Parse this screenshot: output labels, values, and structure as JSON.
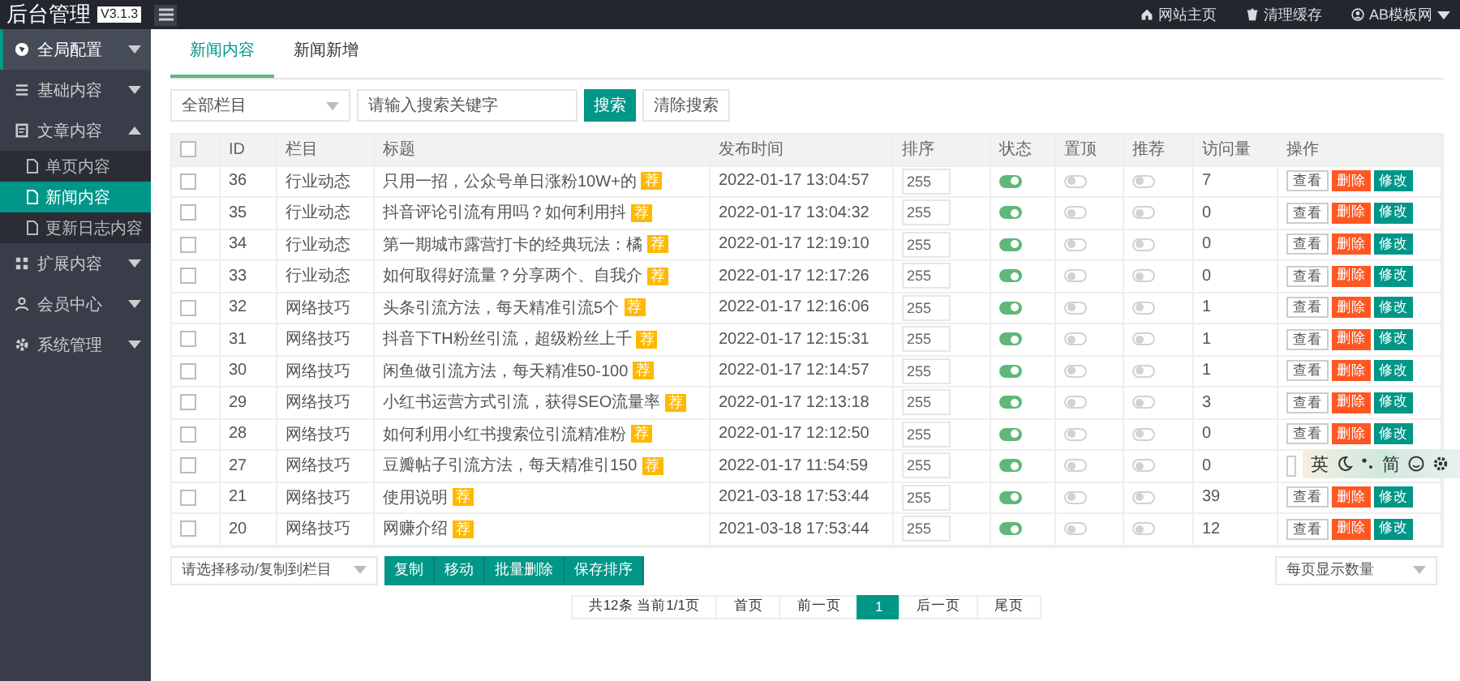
{
  "app": {
    "title": "后台管理",
    "version": "V3.1.3"
  },
  "top_nav": [
    {
      "label": "网站主页"
    },
    {
      "label": "清理缓存"
    },
    {
      "label": "AB模板网",
      "dropdown": true
    }
  ],
  "sidebar": {
    "items": [
      {
        "label": "全局配置",
        "active": true,
        "expanded": false
      },
      {
        "label": "基础内容",
        "active": false,
        "expanded": false
      },
      {
        "label": "文章内容",
        "active": false,
        "expanded": true,
        "children": [
          {
            "label": "单页内容",
            "selected": false
          },
          {
            "label": "新闻内容",
            "selected": true
          },
          {
            "label": "更新日志内容",
            "selected": false
          }
        ]
      },
      {
        "label": "扩展内容",
        "active": false,
        "expanded": false
      },
      {
        "label": "会员中心",
        "active": false,
        "expanded": false
      },
      {
        "label": "系统管理",
        "active": false,
        "expanded": false
      }
    ]
  },
  "tabs": [
    {
      "label": "新闻内容",
      "selected": true
    },
    {
      "label": "新闻新增",
      "selected": false
    }
  ],
  "filter": {
    "category": "全部栏目",
    "search": {
      "placeholder": "请输入搜索关键字"
    },
    "search_button": "搜索",
    "clear_button": "清除搜索"
  },
  "table": {
    "select_all": false,
    "columns": [
      "ID",
      "栏目",
      "标题",
      "发布时间",
      "排序",
      "状态",
      "置顶",
      "推荐",
      "访问量",
      "操作"
    ],
    "rows": [
      {
        "checked": false,
        "id": "36",
        "category": "行业动态",
        "title": "只用一招，公众号单日涨粉10W+的",
        "badge": "荐",
        "time": "2022-01-17 13:04:57",
        "sort": "255",
        "status": true,
        "top": false,
        "recommend": false,
        "visits": "7",
        "actions": [
          "查看",
          "删除",
          "修改"
        ]
      },
      {
        "checked": false,
        "id": "35",
        "category": "行业动态",
        "title": "抖音评论引流有用吗？如何利用抖",
        "badge": "荐",
        "time": "2022-01-17 13:04:32",
        "sort": "255",
        "status": true,
        "top": false,
        "recommend": false,
        "visits": "0",
        "actions": [
          "查看",
          "删除",
          "修改"
        ]
      },
      {
        "checked": false,
        "id": "34",
        "category": "行业动态",
        "title": "第一期城市露营打卡的经典玩法：橘",
        "badge": "荐",
        "time": "2022-01-17 12:19:10",
        "sort": "255",
        "status": true,
        "top": false,
        "recommend": false,
        "visits": "0",
        "actions": [
          "查看",
          "删除",
          "修改"
        ]
      },
      {
        "checked": false,
        "id": "33",
        "category": "行业动态",
        "title": "如何取得好流量？分享两个、自我介",
        "badge": "荐",
        "time": "2022-01-17 12:17:26",
        "sort": "255",
        "status": true,
        "top": false,
        "recommend": false,
        "visits": "0",
        "actions": [
          "查看",
          "删除",
          "修改"
        ]
      },
      {
        "checked": false,
        "id": "32",
        "category": "网络技巧",
        "title": "头条引流方法，每天精准引流5个",
        "badge": "荐",
        "time": "2022-01-17 12:16:06",
        "sort": "255",
        "status": true,
        "top": false,
        "recommend": false,
        "visits": "1",
        "actions": [
          "查看",
          "删除",
          "修改"
        ]
      },
      {
        "checked": false,
        "id": "31",
        "category": "网络技巧",
        "title": "抖音下TH粉丝引流，超级粉丝上千",
        "badge": "荐",
        "time": "2022-01-17 12:15:31",
        "sort": "255",
        "status": true,
        "top": false,
        "recommend": false,
        "visits": "1",
        "actions": [
          "查看",
          "删除",
          "修改"
        ]
      },
      {
        "checked": false,
        "id": "30",
        "category": "网络技巧",
        "title": "闲鱼做引流方法，每天精准50-100",
        "badge": "荐",
        "time": "2022-01-17 12:14:57",
        "sort": "255",
        "status": true,
        "top": false,
        "recommend": false,
        "visits": "1",
        "actions": [
          "查看",
          "删除",
          "修改"
        ]
      },
      {
        "checked": false,
        "id": "29",
        "category": "网络技巧",
        "title": "小红书运营方式引流，获得SEO流量率",
        "badge": "荐",
        "time": "2022-01-17 12:13:18",
        "sort": "255",
        "status": true,
        "top": false,
        "recommend": false,
        "visits": "3",
        "actions": [
          "查看",
          "删除",
          "修改"
        ]
      },
      {
        "checked": false,
        "id": "28",
        "category": "网络技巧",
        "title": "如何利用小红书搜索位引流精准粉",
        "badge": "荐",
        "time": "2022-01-17 12:12:50",
        "sort": "255",
        "status": true,
        "top": false,
        "recommend": false,
        "visits": "0",
        "actions": [
          "查看",
          "删除",
          "修改"
        ]
      },
      {
        "checked": false,
        "id": "27",
        "category": "网络技巧",
        "title": "豆瓣帖子引流方法，每天精准引150",
        "badge": "荐",
        "time": "2022-01-17 11:54:59",
        "sort": "255",
        "status": true,
        "top": false,
        "recommend": false,
        "visits": "0",
        "actions": []
      },
      {
        "checked": false,
        "id": "21",
        "category": "网络技巧",
        "title": "使用说明",
        "badge": "荐",
        "time": "2021-03-18 17:53:44",
        "sort": "255",
        "status": true,
        "top": false,
        "recommend": false,
        "visits": "39",
        "actions": [
          "查看",
          "删除",
          "修改"
        ]
      },
      {
        "checked": false,
        "id": "20",
        "category": "网络技巧",
        "title": "网赚介绍",
        "badge": "荐",
        "time": "2021-03-18 17:53:44",
        "sort": "255",
        "status": true,
        "top": false,
        "recommend": false,
        "visits": "12",
        "actions": [
          "查看",
          "删除",
          "修改"
        ]
      }
    ]
  },
  "bulk": {
    "target": "请选择移动/复制到栏目",
    "buttons": [
      "复制",
      "移动",
      "批量删除",
      "保存排序"
    ],
    "page_size": "每页显示数量"
  },
  "pagination": {
    "summary": "共12条 当前1/1页",
    "pages": [
      {
        "label": "首页",
        "selected": false
      },
      {
        "label": "前一页",
        "selected": false
      },
      {
        "label": "1",
        "selected": true
      },
      {
        "label": "后一页",
        "selected": false
      },
      {
        "label": "尾页",
        "selected": false
      }
    ]
  },
  "ime_bar": {
    "mode": "英",
    "script": "简"
  }
}
